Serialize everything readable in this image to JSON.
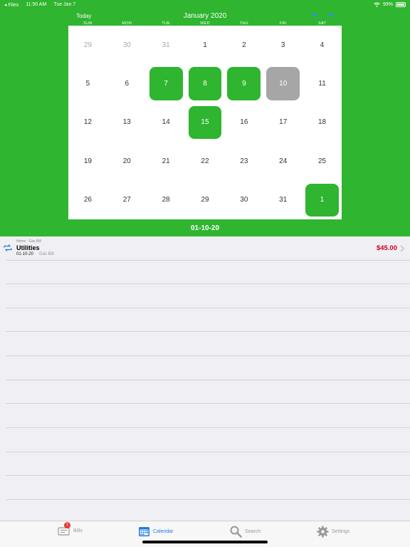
{
  "status_bar": {
    "back_label": "◂ Files",
    "time": "11:50 AM",
    "date": "Tue Jan 7",
    "battery": "99%"
  },
  "header": {
    "today_label": "Today",
    "month_title": "January 2020",
    "prev_icon": "arrow-left-icon",
    "next_icon": "arrow-right-icon"
  },
  "calendar": {
    "weekdays": [
      "SUN",
      "MON",
      "TUE",
      "WED",
      "THU",
      "FRI",
      "SAT"
    ],
    "days": [
      {
        "n": "29",
        "muted": true
      },
      {
        "n": "30",
        "muted": true
      },
      {
        "n": "31",
        "muted": true
      },
      {
        "n": "1"
      },
      {
        "n": "2"
      },
      {
        "n": "3"
      },
      {
        "n": "4"
      },
      {
        "n": "5"
      },
      {
        "n": "6"
      },
      {
        "n": "7",
        "bill": true
      },
      {
        "n": "8",
        "bill": true
      },
      {
        "n": "9",
        "bill": true
      },
      {
        "n": "10",
        "selected": true
      },
      {
        "n": "11"
      },
      {
        "n": "12"
      },
      {
        "n": "13"
      },
      {
        "n": "14"
      },
      {
        "n": "15",
        "bill": true
      },
      {
        "n": "16"
      },
      {
        "n": "17"
      },
      {
        "n": "18"
      },
      {
        "n": "19"
      },
      {
        "n": "20"
      },
      {
        "n": "21"
      },
      {
        "n": "22"
      },
      {
        "n": "23"
      },
      {
        "n": "24"
      },
      {
        "n": "25"
      },
      {
        "n": "26"
      },
      {
        "n": "27"
      },
      {
        "n": "28"
      },
      {
        "n": "29"
      },
      {
        "n": "30"
      },
      {
        "n": "31"
      },
      {
        "n": "1",
        "bill": true
      }
    ],
    "selected_date": "01-10-20"
  },
  "bill": {
    "breadcrumb": "Home : Gas Bill",
    "name": "Utilities",
    "date": "01-10-20",
    "subtitle": "Gas Bill",
    "amount": "$45.00",
    "icon": "repeat-icon"
  },
  "tabs": {
    "bills": {
      "label": "Bills",
      "badge": "1"
    },
    "calendar": {
      "label": "Calendar"
    },
    "search": {
      "label": "Search"
    },
    "settings": {
      "label": "Settings"
    }
  },
  "colors": {
    "brand_green": "#2fb52f",
    "selected_gray": "#a6a6a6",
    "amount_red": "#d0021b",
    "active_blue": "#1f7ae0"
  }
}
